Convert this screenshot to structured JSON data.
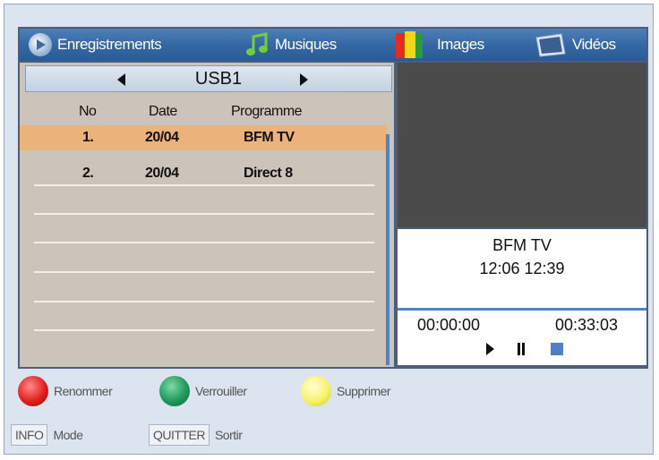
{
  "tabs": [
    {
      "label": "Enregistrements",
      "icon": "record-icon"
    },
    {
      "label": "Musiques",
      "icon": "music-note-icon"
    },
    {
      "label": "Images",
      "icon": "images-icon"
    },
    {
      "label": "Vidéos",
      "icon": "video-icon"
    }
  ],
  "device": {
    "label": "USB1"
  },
  "table": {
    "headers": [
      "No",
      "Date",
      "Programme"
    ],
    "rows": [
      {
        "no": "1.",
        "date": "20/04",
        "programme": "BFM TV",
        "selected": true
      },
      {
        "no": "2.",
        "date": "20/04",
        "programme": "Direct 8",
        "selected": false
      }
    ]
  },
  "info": {
    "channel": "BFM TV",
    "time": "12:06  12:39"
  },
  "player": {
    "elapsed": "00:00:00",
    "duration": "00:33:03"
  },
  "color_buttons": [
    {
      "color": "red",
      "label": "Renommer"
    },
    {
      "color": "green",
      "label": "Verrouiller"
    },
    {
      "color": "yellow",
      "label": "Supprimer"
    }
  ],
  "keys": [
    {
      "key": "INFO",
      "label": "Mode"
    },
    {
      "key": "QUITTER",
      "label": "Sortir"
    }
  ],
  "colors": {
    "selected_row": "#ebb27a",
    "accent": "#4f83c1",
    "tabbar": "#3266a3"
  }
}
